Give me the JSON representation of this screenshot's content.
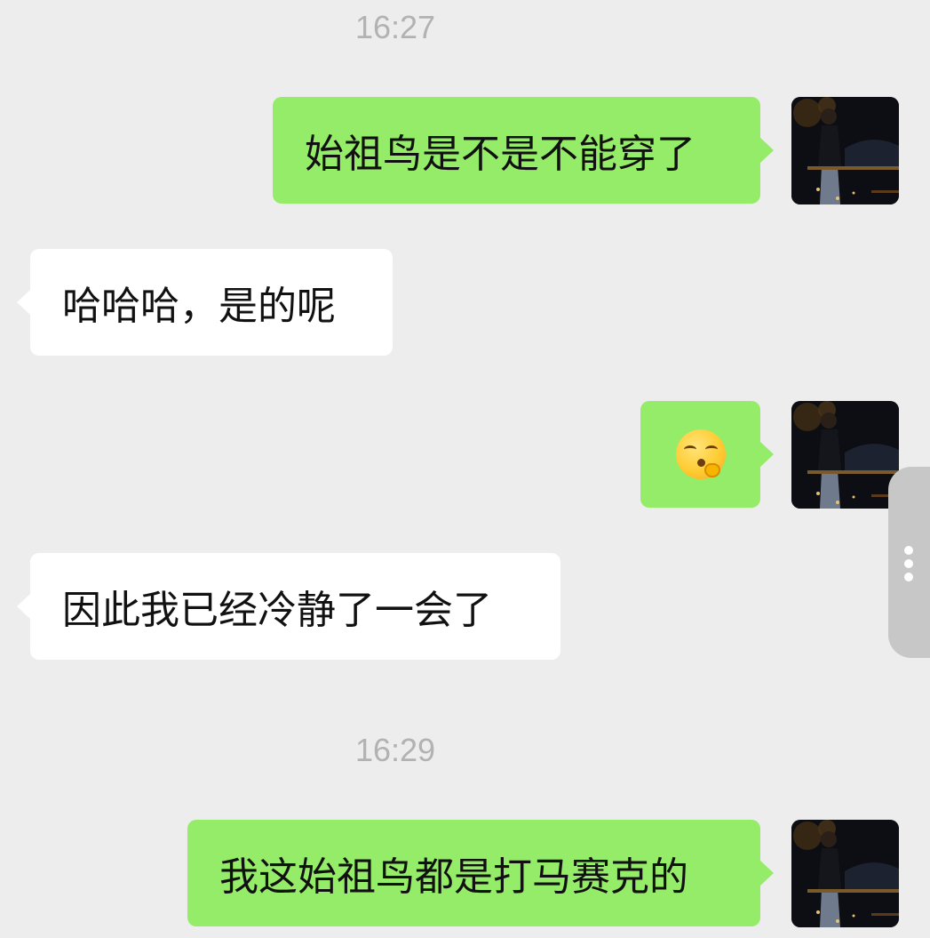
{
  "chat": {
    "timestamps": [
      "16:27",
      "16:29"
    ],
    "messages": [
      {
        "sender": "me",
        "text": "始祖鸟是不是不能穿了"
      },
      {
        "sender": "other",
        "text": "哈哈哈，是的呢"
      },
      {
        "sender": "me",
        "type": "emoji",
        "emoji": "shushing-face-emoji"
      },
      {
        "sender": "other",
        "text": "因此我已经冷静了一会了"
      },
      {
        "sender": "me",
        "text": "我这始祖鸟都是打马赛克的"
      }
    ]
  },
  "colors": {
    "background": "#ededed",
    "sent_bubble": "#95ec69",
    "received_bubble": "#ffffff",
    "timestamp_text": "#b2b2b2"
  }
}
